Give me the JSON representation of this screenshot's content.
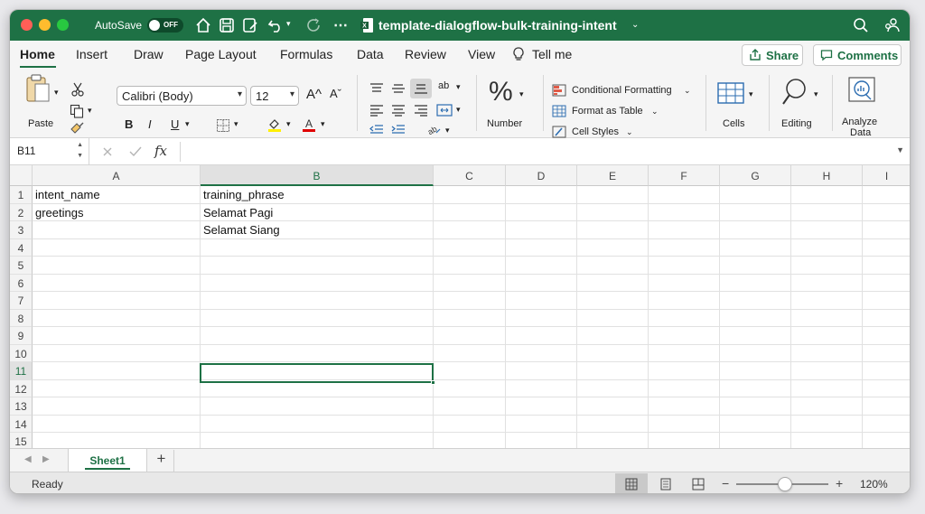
{
  "titlebar": {
    "autosave_label": "AutoSave",
    "autosave_state": "OFF",
    "document_title": "template-dialogflow-bulk-training-intent",
    "more_glyph": "⋯"
  },
  "ribbon_tabs": [
    "Home",
    "Insert",
    "Draw",
    "Page Layout",
    "Formulas",
    "Data",
    "Review",
    "View"
  ],
  "tell_me": "Tell me",
  "share_label": "Share",
  "comments_label": "Comments",
  "ribbon": {
    "paste_label": "Paste",
    "font_name": "Calibri (Body)",
    "font_size": "12",
    "bold": "B",
    "italic": "I",
    "underline": "U",
    "number_label": "Number",
    "conditional_formatting": "Conditional Formatting",
    "format_as_table": "Format as Table",
    "cell_styles": "Cell Styles",
    "cells_label": "Cells",
    "editing_label": "Editing",
    "analyze_label_1": "Analyze",
    "analyze_label_2": "Data",
    "grow_font": "A^",
    "shrink_font": "Aˇ",
    "wrap_text": "ab"
  },
  "formula_bar": {
    "name_box": "B11",
    "fx": "fx",
    "content": ""
  },
  "columns": [
    "A",
    "B",
    "C",
    "D",
    "E",
    "F",
    "G",
    "H",
    "I"
  ],
  "selected_column": "B",
  "rows": [
    "1",
    "2",
    "3",
    "4",
    "5",
    "6",
    "7",
    "8",
    "9",
    "10",
    "11",
    "12",
    "13",
    "14",
    "15"
  ],
  "selected_row": "11",
  "cells": {
    "A1": "intent_name",
    "B1": "training_phrase",
    "A2": "greetings",
    "B2": "Selamat Pagi",
    "B3": "Selamat Siang"
  },
  "sheet_tab": "Sheet1",
  "add_sheet": "+",
  "status": {
    "ready": "Ready",
    "zoom": "120%",
    "zoom_minus": "−",
    "zoom_plus": "+"
  },
  "colors": {
    "brand_green": "#1e7145",
    "close": "#ff5f57",
    "minimize": "#febc2e",
    "maximize": "#28c840"
  }
}
